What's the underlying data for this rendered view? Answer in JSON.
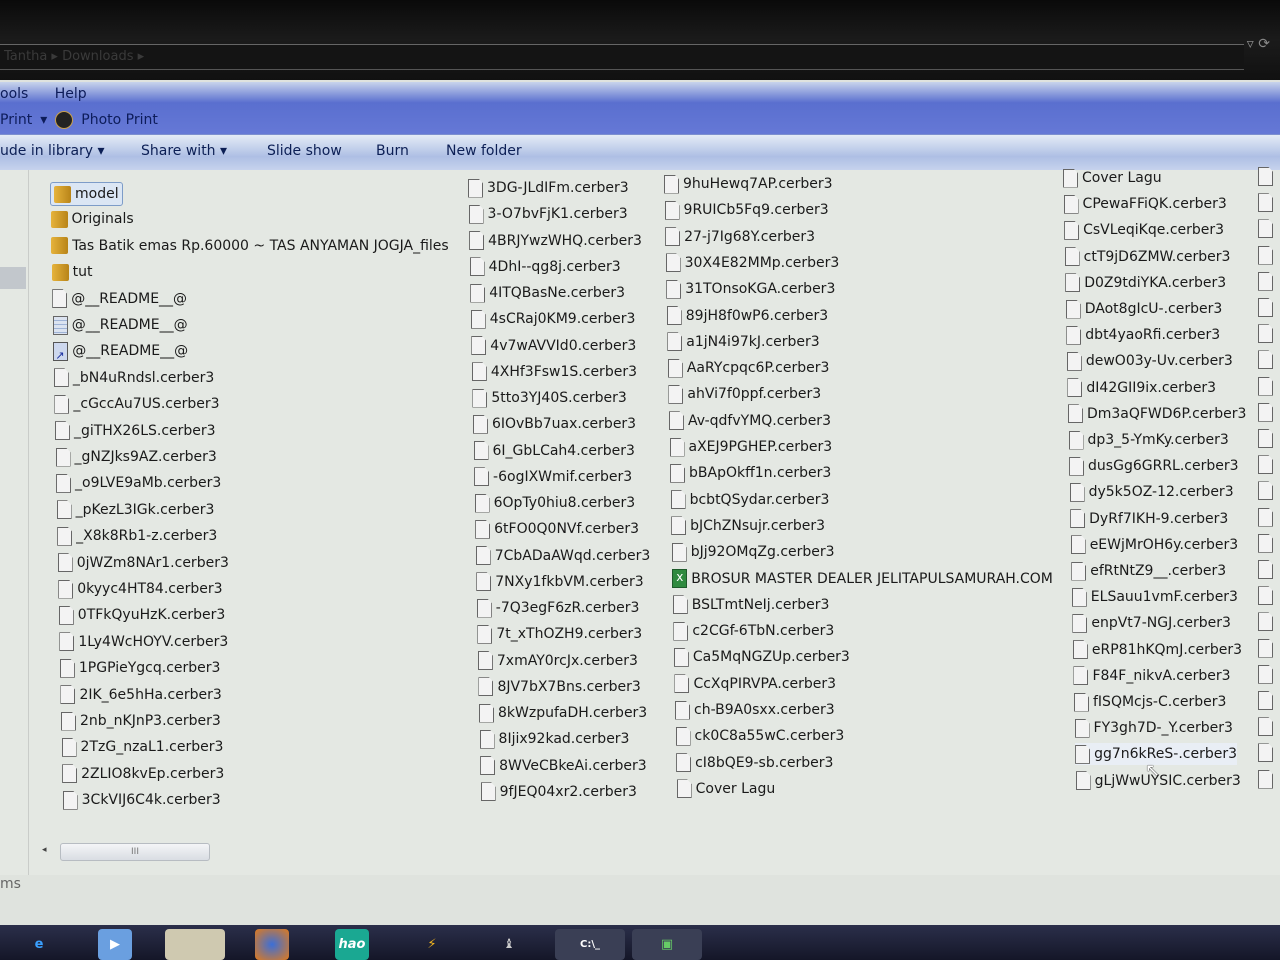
{
  "window": {
    "address": "Tantha ▸ Downloads ▸"
  },
  "menu": {
    "items": [
      "ools",
      "Help"
    ],
    "print": "Print",
    "photo_print": "Photo Print"
  },
  "toolbar": {
    "include_library": "ude in library ▾",
    "share_with": "Share with ▾",
    "slide_show": "Slide show",
    "burn": "Burn",
    "new_folder": "New folder"
  },
  "files": {
    "columns": [
      [
        {
          "name": "model",
          "icon": "folder",
          "selected": true
        },
        {
          "name": "Originals",
          "icon": "folder"
        },
        {
          "name": "Tas Batik emas Rp.60000 ~ TAS ANYAMAN JOGJA_files",
          "icon": "folder"
        },
        {
          "name": "tut",
          "icon": "folder"
        },
        {
          "name": "@__README__@",
          "icon": "file"
        },
        {
          "name": "@__README__@",
          "icon": "notepad"
        },
        {
          "name": "@__README__@",
          "icon": "shortcut"
        },
        {
          "name": "_bN4uRndsl.cerber3",
          "icon": "file"
        },
        {
          "name": "_cGccAu7US.cerber3",
          "icon": "file"
        },
        {
          "name": "_giTHX26LS.cerber3",
          "icon": "file"
        },
        {
          "name": "_gNZJks9AZ.cerber3",
          "icon": "file"
        },
        {
          "name": "_o9LVE9aMb.cerber3",
          "icon": "file"
        },
        {
          "name": "_pKezL3IGk.cerber3",
          "icon": "file"
        },
        {
          "name": "_X8k8Rb1-z.cerber3",
          "icon": "file"
        },
        {
          "name": "0jWZm8NAr1.cerber3",
          "icon": "file"
        },
        {
          "name": "0kyyc4HT84.cerber3",
          "icon": "file"
        },
        {
          "name": "0TFkQyuHzK.cerber3",
          "icon": "file"
        },
        {
          "name": "1Ly4WcHOYV.cerber3",
          "icon": "file"
        },
        {
          "name": "1PGPieYgcq.cerber3",
          "icon": "file"
        },
        {
          "name": "2IK_6e5hHa.cerber3",
          "icon": "file"
        },
        {
          "name": "2nb_nKJnP3.cerber3",
          "icon": "file"
        },
        {
          "name": "2TzG_nzaL1.cerber3",
          "icon": "file"
        },
        {
          "name": "2ZLIO8kvEp.cerber3",
          "icon": "file"
        },
        {
          "name": "3CkVIJ6C4k.cerber3",
          "icon": "file"
        }
      ],
      [
        {
          "name": "3DG-JLdIFm.cerber3",
          "icon": "file"
        },
        {
          "name": "3-O7bvFjK1.cerber3",
          "icon": "file"
        },
        {
          "name": "4BRJYwzWHQ.cerber3",
          "icon": "file"
        },
        {
          "name": "4DhI--qg8j.cerber3",
          "icon": "file"
        },
        {
          "name": "4ITQBasNe.cerber3",
          "icon": "file"
        },
        {
          "name": "4sCRaj0KM9.cerber3",
          "icon": "file"
        },
        {
          "name": "4v7wAVVId0.cerber3",
          "icon": "file"
        },
        {
          "name": "4XHf3Fsw1S.cerber3",
          "icon": "file"
        },
        {
          "name": "5tto3YJ40S.cerber3",
          "icon": "file"
        },
        {
          "name": "6IOvBb7uax.cerber3",
          "icon": "file"
        },
        {
          "name": "6I_GbLCah4.cerber3",
          "icon": "file"
        },
        {
          "name": "-6ogIXWmif.cerber3",
          "icon": "file"
        },
        {
          "name": "6OpTy0hiu8.cerber3",
          "icon": "file"
        },
        {
          "name": "6tFO0Q0NVf.cerber3",
          "icon": "file"
        },
        {
          "name": "7CbADaAWqd.cerber3",
          "icon": "file"
        },
        {
          "name": "7NXy1fkbVM.cerber3",
          "icon": "file"
        },
        {
          "name": "-7Q3egF6zR.cerber3",
          "icon": "file"
        },
        {
          "name": "7t_xThOZH9.cerber3",
          "icon": "file"
        },
        {
          "name": "7xmAY0rcJx.cerber3",
          "icon": "file"
        },
        {
          "name": "8JV7bX7Bns.cerber3",
          "icon": "file"
        },
        {
          "name": "8kWzpufaDH.cerber3",
          "icon": "file"
        },
        {
          "name": "8Ijix92kad.cerber3",
          "icon": "file"
        },
        {
          "name": "8WVeCBkeAi.cerber3",
          "icon": "file"
        },
        {
          "name": "9fJEQ04xr2.cerber3",
          "icon": "file"
        }
      ],
      [
        {
          "name": "9huHewq7AP.cerber3",
          "icon": "file"
        },
        {
          "name": "9RUICb5Fq9.cerber3",
          "icon": "file"
        },
        {
          "name": "27-j7Ig68Y.cerber3",
          "icon": "file"
        },
        {
          "name": "30X4E82MMp.cerber3",
          "icon": "file"
        },
        {
          "name": "31TOnsoKGA.cerber3",
          "icon": "file"
        },
        {
          "name": "89jH8f0wP6.cerber3",
          "icon": "file"
        },
        {
          "name": "a1jN4i97kJ.cerber3",
          "icon": "file"
        },
        {
          "name": "AaRYcpqc6P.cerber3",
          "icon": "file"
        },
        {
          "name": "ahVi7f0ppf.cerber3",
          "icon": "file"
        },
        {
          "name": "Av-qdfvYMQ.cerber3",
          "icon": "file"
        },
        {
          "name": "aXEJ9PGHEP.cerber3",
          "icon": "file"
        },
        {
          "name": "bBApOkff1n.cerber3",
          "icon": "file"
        },
        {
          "name": "bcbtQSydar.cerber3",
          "icon": "file"
        },
        {
          "name": "bJChZNsujr.cerber3",
          "icon": "file"
        },
        {
          "name": "bJj92OMqZg.cerber3",
          "icon": "file"
        },
        {
          "name": "BROSUR MASTER DEALER JELITAPULSAMURAH.COM",
          "icon": "excel"
        },
        {
          "name": "BSLTmtNeIj.cerber3",
          "icon": "file"
        },
        {
          "name": "c2CGf-6TbN.cerber3",
          "icon": "file"
        },
        {
          "name": "Ca5MqNGZUp.cerber3",
          "icon": "file"
        },
        {
          "name": "CcXqPIRVPA.cerber3",
          "icon": "file"
        },
        {
          "name": "ch-B9A0sxx.cerber3",
          "icon": "file"
        },
        {
          "name": "ck0C8a55wC.cerber3",
          "icon": "file"
        },
        {
          "name": "cI8bQE9-sb.cerber3",
          "icon": "file"
        },
        {
          "name": "Cover Lagu",
          "icon": "file"
        }
      ],
      [
        {
          "name": "Cover Lagu",
          "icon": "file"
        },
        {
          "name": "CPewaFFiQK.cerber3",
          "icon": "file"
        },
        {
          "name": "CsVLeqiKqe.cerber3",
          "icon": "file"
        },
        {
          "name": "ctT9jD6ZMW.cerber3",
          "icon": "file"
        },
        {
          "name": "D0Z9tdiYKA.cerber3",
          "icon": "file"
        },
        {
          "name": "DAot8gIcU-.cerber3",
          "icon": "file"
        },
        {
          "name": "dbt4yaoRfi.cerber3",
          "icon": "file"
        },
        {
          "name": "dewO03y-Uv.cerber3",
          "icon": "file"
        },
        {
          "name": "dI42GII9ix.cerber3",
          "icon": "file"
        },
        {
          "name": "Dm3aQFWD6P.cerber3",
          "icon": "file"
        },
        {
          "name": "dp3_5-YmKy.cerber3",
          "icon": "file"
        },
        {
          "name": "dusGg6GRRL.cerber3",
          "icon": "file"
        },
        {
          "name": "dy5k5OZ-12.cerber3",
          "icon": "file"
        },
        {
          "name": "DyRf7IKH-9.cerber3",
          "icon": "file"
        },
        {
          "name": "eEWjMrOH6y.cerber3",
          "icon": "file"
        },
        {
          "name": "efRtNtZ9__.cerber3",
          "icon": "file"
        },
        {
          "name": "ELSauu1vmF.cerber3",
          "icon": "file"
        },
        {
          "name": "enpVt7-NGJ.cerber3",
          "icon": "file"
        },
        {
          "name": "eRP81hKQmJ.cerber3",
          "icon": "file"
        },
        {
          "name": "F84F_nikvA.cerber3",
          "icon": "file"
        },
        {
          "name": "fISQMcjs-C.cerber3",
          "icon": "file"
        },
        {
          "name": "FY3gh7D-_Y.cerber3",
          "icon": "file"
        },
        {
          "name": "gg7n6kReS-.cerber3",
          "icon": "file",
          "hovered": true
        },
        {
          "name": "gLjWwUYSIC.cerber3",
          "icon": "file"
        }
      ]
    ]
  },
  "scrollbar": {
    "grip": "III"
  },
  "status": {
    "text": "ms"
  },
  "taskbar": {
    "cmd_label": "C:\\_",
    "hao_label": "hao"
  }
}
